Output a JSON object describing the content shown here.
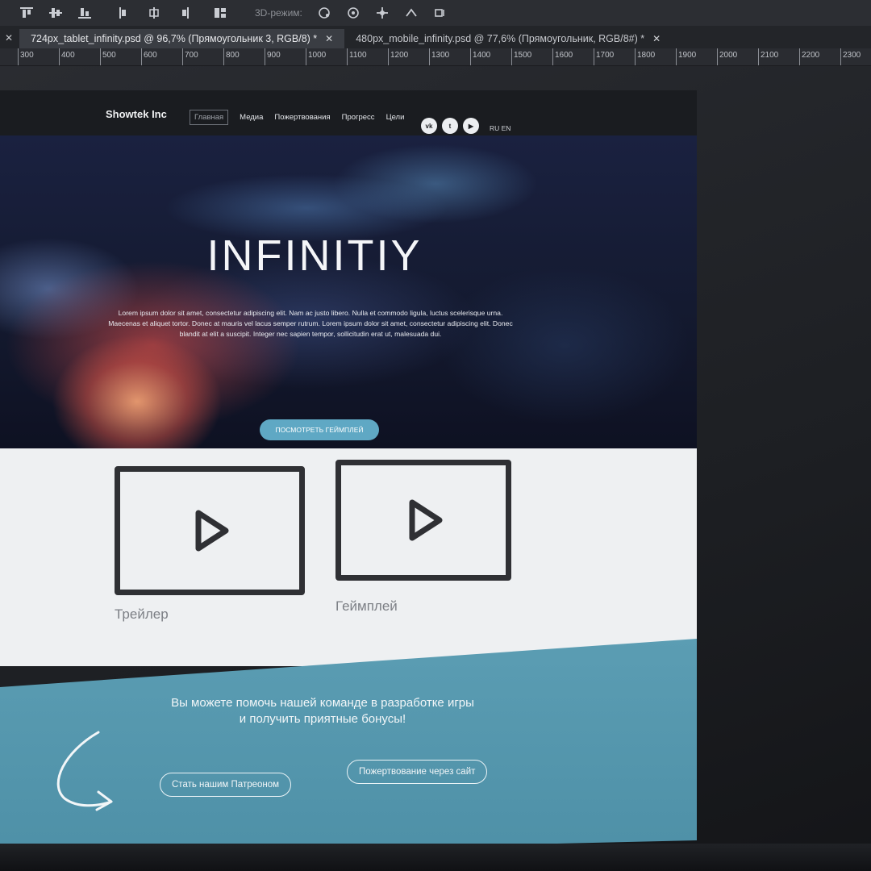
{
  "photoshop": {
    "toolbar": {
      "mode_3d_label": "3D-режим:",
      "tools": [
        "align-top-icon",
        "align-vcenter-icon",
        "align-bottom-icon",
        "distribute-left-icon",
        "distribute-hcenter-icon",
        "distribute-right-icon",
        "auto-align-icon",
        "orbit-3d-icon",
        "roll-3d-icon",
        "pan-3d-icon",
        "slide-3d-icon",
        "scale-3d-icon"
      ]
    },
    "tabs": [
      {
        "label": "724px_tablet_infinity.psd @ 96,7% (Прямоугольник 3, RGB/8) *",
        "active": true
      },
      {
        "label": "480px_mobile_infinity.psd @ 77,6% (Прямоугольник, RGB/8#) *",
        "active": false
      }
    ],
    "ruler": [
      "300",
      "400",
      "500",
      "600",
      "700",
      "800",
      "900",
      "1000",
      "1100",
      "1200",
      "1300",
      "1400",
      "1500",
      "1600",
      "1700",
      "1800",
      "1900",
      "2000",
      "2100",
      "2200",
      "2300"
    ]
  },
  "site": {
    "brand": "Showtek Inc",
    "nav": [
      {
        "label": "Главная",
        "active": true
      },
      {
        "label": "Медиа",
        "active": false
      },
      {
        "label": "Пожертвования",
        "active": false
      },
      {
        "label": "Прогресс",
        "active": false
      },
      {
        "label": "Цели",
        "active": false
      }
    ],
    "socials": [
      {
        "icon": "vk-icon",
        "glyph": "vk"
      },
      {
        "icon": "twitter-icon",
        "glyph": "t"
      },
      {
        "icon": "youtube-icon",
        "glyph": "▶"
      }
    ],
    "lang": "RU EN",
    "hero": {
      "title": "INFINITIY",
      "text": "Lorem ipsum dolor sit amet, consectetur adipiscing elit. Nam ac justo libero. Nulla et commodo ligula, luctus scelerisque urna. Maecenas et aliquet tortor. Donec at mauris vel lacus semper rutrum. Lorem ipsum dolor sit amet, consectetur adipiscing elit. Donec blandit at elit a suscipit. Integer nec sapien tempor, sollicitudin erat ut, malesuada dui.",
      "button": "Посмотреть геймплей"
    },
    "videos": [
      {
        "label": "Трейлер"
      },
      {
        "label": "Геймплей"
      }
    ],
    "donate": {
      "text_line1": "Вы можете помочь нашей команде в разработке игры",
      "text_line2": "и получить приятные бонусы!",
      "patreon_button": "Стать нашим Патреоном",
      "site_button": "Пожертвование через сайт"
    }
  },
  "colors": {
    "accent": "#5fa8c4",
    "donate_bg": "#5b9db3",
    "nav_bg": "#1a1c20",
    "video_bg": "#eef0f2"
  }
}
